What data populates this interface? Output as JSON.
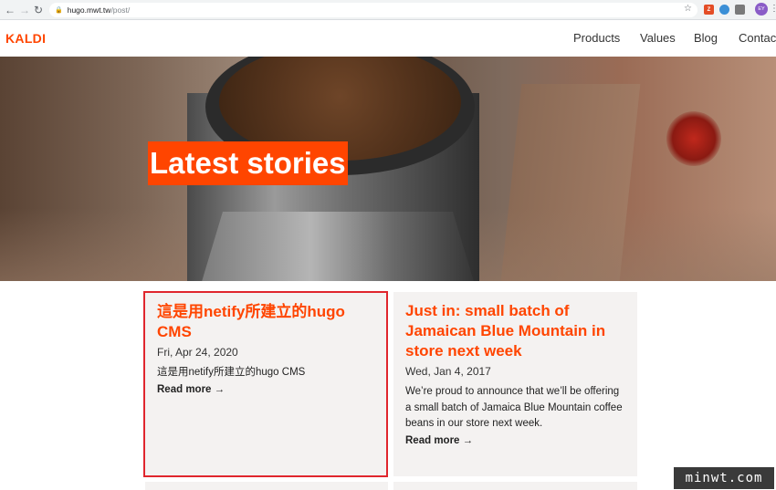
{
  "browser": {
    "url_host": "hugo.mwt.tw",
    "url_path": "/post/",
    "avatar_text": "EY"
  },
  "site": {
    "logo": "KALDI",
    "nav": [
      "Products",
      "Values",
      "Blog",
      "Contact"
    ]
  },
  "hero": {
    "title": "Latest stories"
  },
  "posts": [
    {
      "title": "這是用netify所建立的hugo CMS",
      "date": "Fri, Apr 24, 2020",
      "excerpt": "這是用netify所建立的hugo CMS",
      "read_more": "Read more →"
    },
    {
      "title": "Just in: small batch of Jamaican Blue Mountain in store next week",
      "date": "Wed, Jan 4, 2017",
      "excerpt": "We’re proud to announce that we’ll be offering a small batch of Jamaica Blue Mountain coffee beans in our store next week.",
      "read_more": "Read more →"
    }
  ],
  "watermark": "minwt.com",
  "colors": {
    "accent": "#ff4500",
    "highlight_border": "#e0262d",
    "card_bg": "#f4f2f1"
  }
}
